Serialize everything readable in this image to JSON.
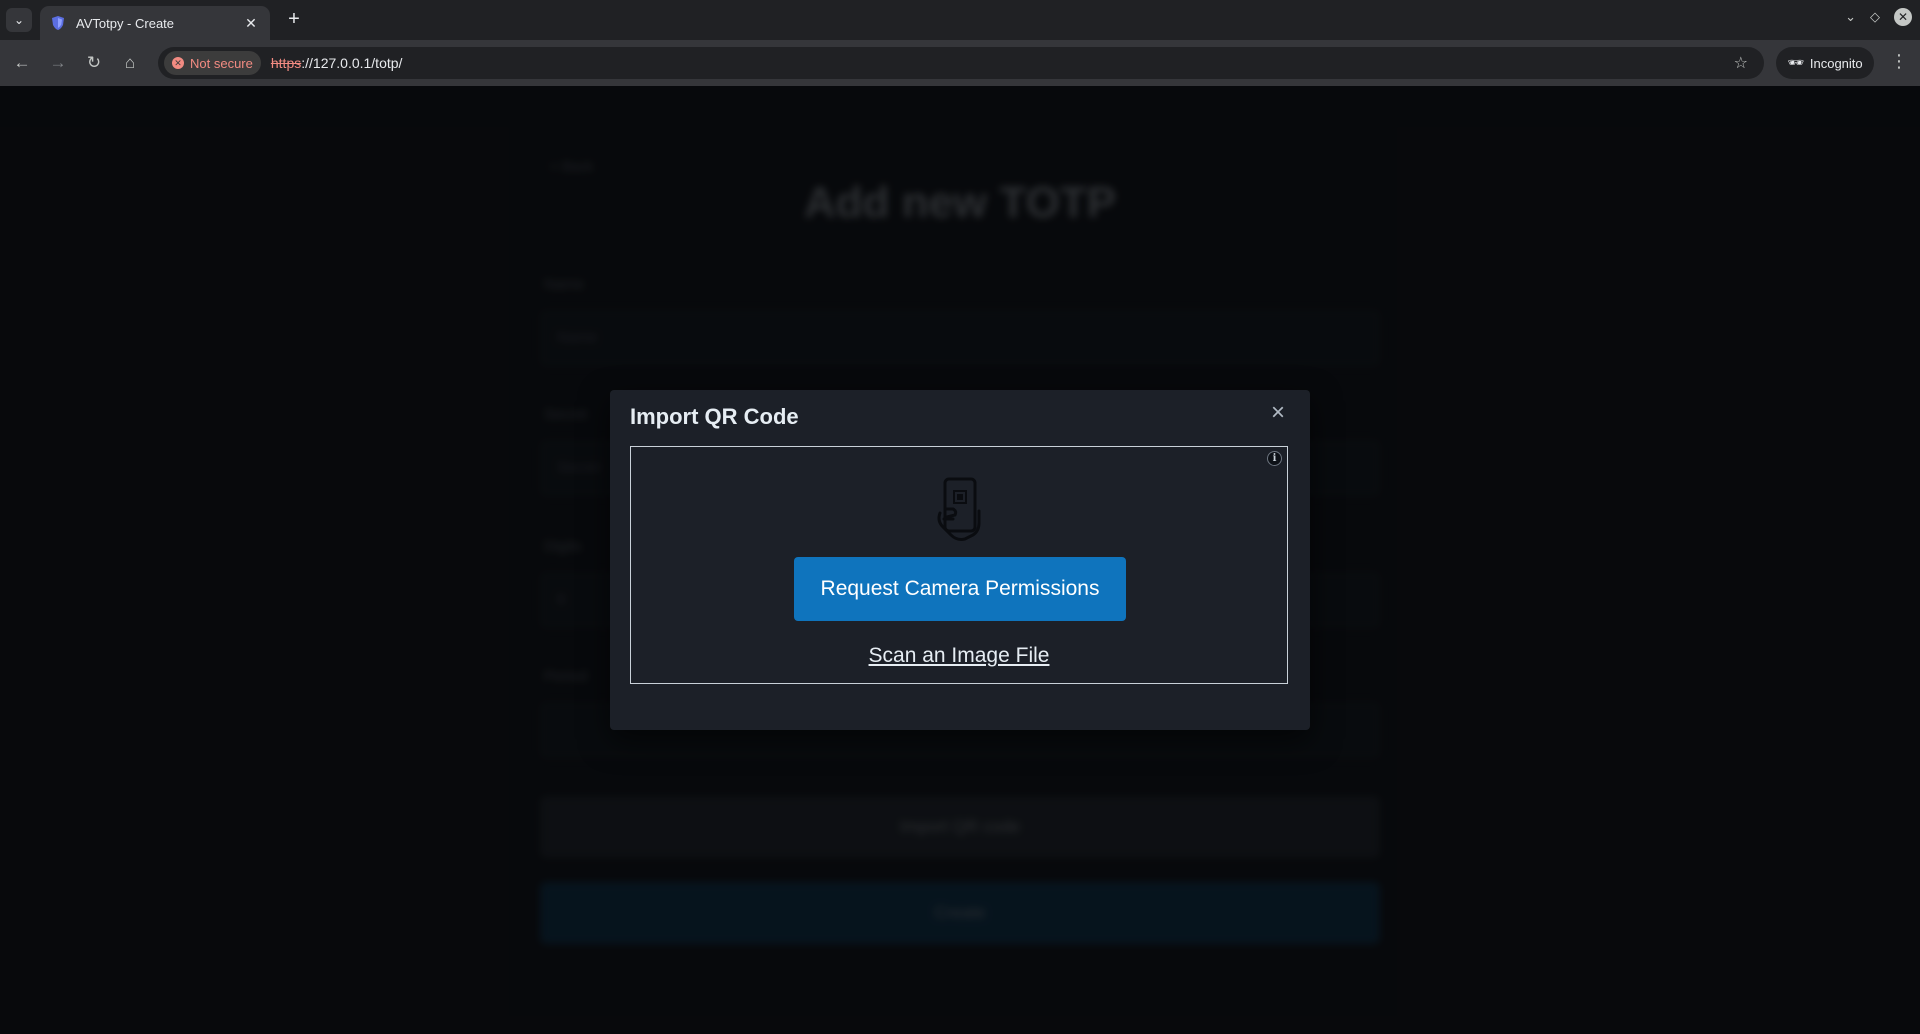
{
  "browser": {
    "tab_title": "AVTotpy - Create",
    "new_tab_symbol": "+",
    "security_label": "Not secure",
    "url_scheme": "https",
    "url_rest": "://127.0.0.1/totp/",
    "incognito_label": "Incognito",
    "favicon_color": "#5b6ee1"
  },
  "background_page": {
    "back_link": "< Back",
    "title": "Add new TOTP",
    "fields": [
      {
        "label": "Name",
        "placeholder": "Name"
      },
      {
        "label": "Secret",
        "placeholder": "Secret"
      },
      {
        "label": "Digits",
        "placeholder": "6"
      },
      {
        "label": "Period",
        "placeholder": ""
      }
    ],
    "import_button": "Import QR code",
    "create_button": "Create"
  },
  "modal": {
    "title": "Import QR Code",
    "close_symbol": "×",
    "info_symbol": "i",
    "request_button": "Request Camera Permissions",
    "scan_link": "Scan an Image File",
    "accent_color": "#0f74bd"
  }
}
